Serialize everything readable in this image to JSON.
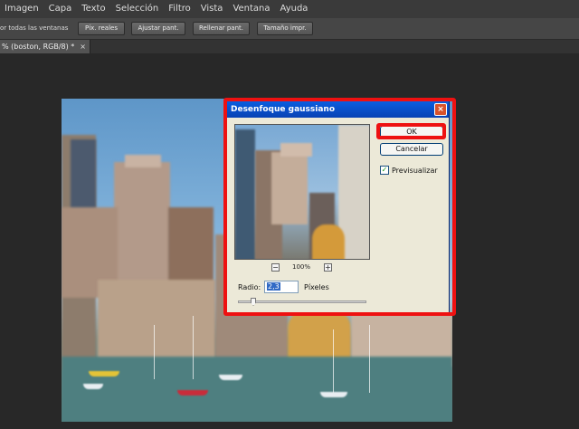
{
  "menu": [
    "Imagen",
    "Capa",
    "Texto",
    "Selección",
    "Filtro",
    "Vista",
    "Ventana",
    "Ayuda"
  ],
  "options": {
    "scroll_all_label": "or todas las ventanas",
    "buttons": [
      "Píx. reales",
      "Ajustar pant.",
      "Rellenar pant.",
      "Tamaño impr."
    ]
  },
  "tab": {
    "title": "% (boston, RGB/8) *",
    "close": "×"
  },
  "dialog": {
    "title": "Desenfoque gaussiano",
    "close": "×",
    "ok": "OK",
    "cancel": "Cancelar",
    "preview_label": "Previsualizar",
    "preview_checked": true,
    "zoom_out": "−",
    "zoom_in": "+",
    "zoom": "100%",
    "radius_label": "Radio:",
    "radius_value": "2,3",
    "radius_unit": "Píxeles",
    "slider_fraction": 0.12
  },
  "colors": {
    "annotation": "#ee1111",
    "titlebar": "#0a5ee0"
  }
}
